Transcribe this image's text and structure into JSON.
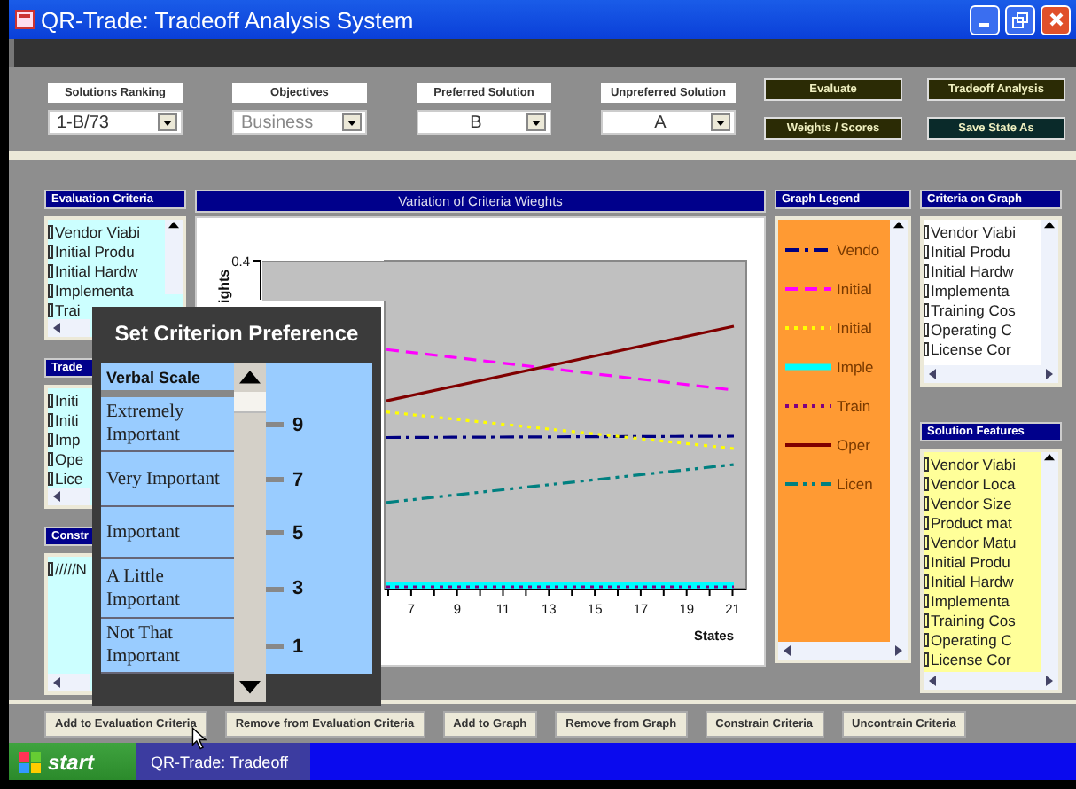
{
  "window": {
    "title": "QR-Trade: Tradeoff Analysis System"
  },
  "toolbar": {
    "dropdowns": [
      {
        "label": "Solutions Ranking",
        "value": "1-B/73",
        "disabled": false
      },
      {
        "label": "Objectives",
        "value": "Business",
        "disabled": true
      },
      {
        "label": "Preferred Solution",
        "value": "B",
        "disabled": false
      },
      {
        "label": "Unpreferred Solution",
        "value": "A",
        "disabled": false
      }
    ],
    "buttons": [
      {
        "label": "Evaluate",
        "color": "#2b2b05"
      },
      {
        "label": "Tradeoff Analysis",
        "color": "#2b2b05"
      },
      {
        "label": "Weights / Scores",
        "color": "#2b2b05"
      },
      {
        "label": "Save State As",
        "color": "#0a2a2a"
      }
    ]
  },
  "left_panels": [
    {
      "title": "Evaluation Criteria",
      "color": "#ccffff",
      "items": [
        {
          "label": "Vendor Viabi",
          "checked": false
        },
        {
          "label": "Initial Produ",
          "checked": false
        },
        {
          "label": "Initial Hardw",
          "checked": false
        },
        {
          "label": "Implementa",
          "checked": false
        },
        {
          "label": "Trai",
          "checked": false
        }
      ]
    },
    {
      "title": "Trade",
      "color": "#ccffff",
      "items": [
        {
          "label": "Initi",
          "checked": false
        },
        {
          "label": "Initi",
          "checked": false
        },
        {
          "label": "Imp",
          "checked": false
        },
        {
          "label": "Ope",
          "checked": false
        },
        {
          "label": "Lice",
          "checked": false
        }
      ]
    },
    {
      "title": "Constr",
      "color": "#ccffff",
      "items": [
        {
          "label": "/////N",
          "checked": false
        }
      ]
    }
  ],
  "chart": {
    "title": "Variation of Criteria Wieghts",
    "y_label": "ights",
    "y_tick": "0.4",
    "x_ticks": [
      "7",
      "9",
      "11",
      "13",
      "15",
      "17",
      "19",
      "21"
    ],
    "x_label": "States"
  },
  "legend": {
    "title": "Graph Legend",
    "items": [
      {
        "label": "Vendo",
        "color": "#000080",
        "kind": "dash-dot"
      },
      {
        "label": "Initial",
        "color": "#ff00ff",
        "kind": "dash"
      },
      {
        "label": "Initial",
        "color": "#ffff00",
        "kind": "dot"
      },
      {
        "label": "Imple",
        "color": "#00ffff",
        "kind": "solid"
      },
      {
        "label": "Train",
        "color": "#800080",
        "kind": "dot"
      },
      {
        "label": "Oper",
        "color": "#800000",
        "kind": "solid"
      },
      {
        "label": "Licen",
        "color": "#008080",
        "kind": "dash-dot-dot"
      }
    ]
  },
  "right_panels": [
    {
      "title": "Criteria on Graph",
      "color": "#ffffff",
      "items": [
        {
          "label": "Vendor Viabi",
          "checked": false
        },
        {
          "label": "Initial Produ",
          "checked": false
        },
        {
          "label": "Initial Hardw",
          "checked": false
        },
        {
          "label": "Implementa",
          "checked": false
        },
        {
          "label": "Training Cos",
          "checked": false
        },
        {
          "label": "Operating C",
          "checked": false
        },
        {
          "label": "License Cor",
          "checked": false
        }
      ]
    },
    {
      "title": "Solution Features",
      "color": "#ffff99",
      "items": [
        {
          "label": "Vendor Viabi",
          "checked": false
        },
        {
          "label": "Vendor Loca",
          "checked": false
        },
        {
          "label": "Vendor Size",
          "checked": false
        },
        {
          "label": "Product mat",
          "checked": false
        },
        {
          "label": "Vendor Matu",
          "checked": false
        },
        {
          "label": "Initial Produ",
          "checked": false
        },
        {
          "label": "Initial Hardw",
          "checked": false
        },
        {
          "label": "Implementa",
          "checked": false
        },
        {
          "label": "Training Cos",
          "checked": false
        },
        {
          "label": "Operating C",
          "checked": false
        },
        {
          "label": "License Cor",
          "checked": false
        }
      ]
    }
  ],
  "popup": {
    "title": "Set Criterion Preference",
    "header": "Verbal Scale",
    "options": [
      {
        "label": "Extremely Important",
        "value": "9"
      },
      {
        "label": "Very Important",
        "value": "7"
      },
      {
        "label": "Important",
        "value": "5"
      },
      {
        "label": "A Little Important",
        "value": "3"
      },
      {
        "label": "Not That Important",
        "value": "1"
      }
    ]
  },
  "bottom_buttons": [
    "Add to Evaluation Criteria",
    "Remove from Evaluation Criteria",
    "Add to Graph",
    "Remove from Graph",
    "Constrain Criteria",
    "Uncontrain Criteria"
  ],
  "taskbar": {
    "start": "start",
    "task": "QR-Trade: Tradeoff"
  }
}
